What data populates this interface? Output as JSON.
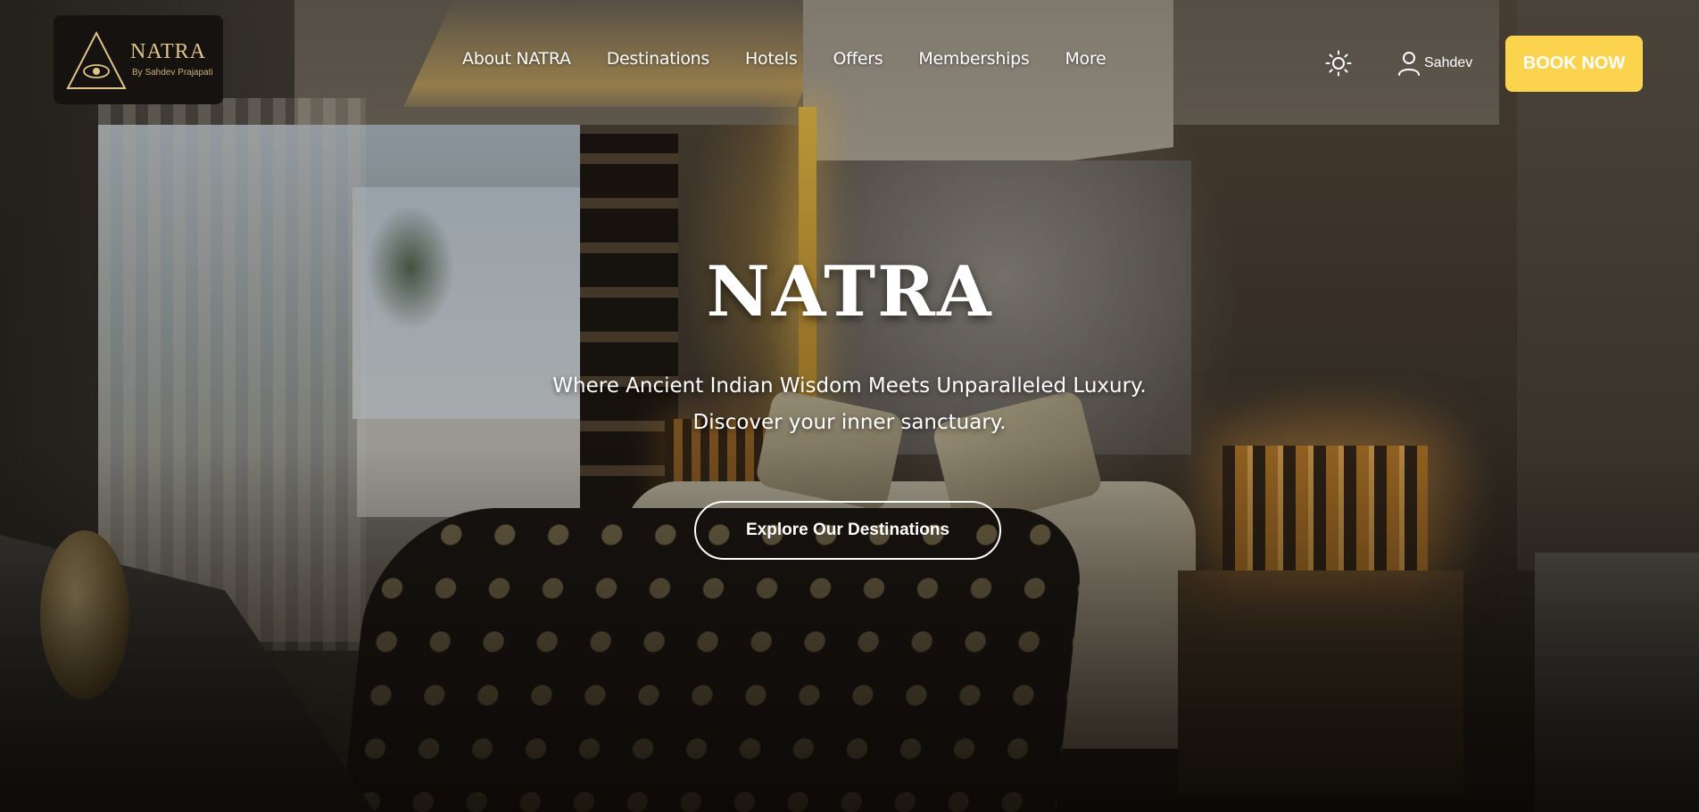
{
  "brand": {
    "name": "NATRA",
    "tagline": "By Sahdev Prajapati",
    "accent_color": "#fcd34d",
    "logo_color": "#e0c488"
  },
  "nav": {
    "items": [
      {
        "label": "About NATRA"
      },
      {
        "label": "Destinations"
      },
      {
        "label": "Hotels"
      },
      {
        "label": "Offers"
      },
      {
        "label": "Memberships"
      },
      {
        "label": "More"
      }
    ]
  },
  "header": {
    "theme_icon": "sun-icon",
    "user_icon": "user-icon",
    "user_name": "Sahdev",
    "book_label": "BOOK NOW"
  },
  "hero": {
    "title": "NATRA",
    "subtitle_line1": "Where Ancient Indian Wisdom Meets Unparalleled Luxury.",
    "subtitle_line2": "Discover your inner sanctuary.",
    "cta_label": "Explore Our Destinations",
    "background": "luxury-bedroom-photo"
  }
}
